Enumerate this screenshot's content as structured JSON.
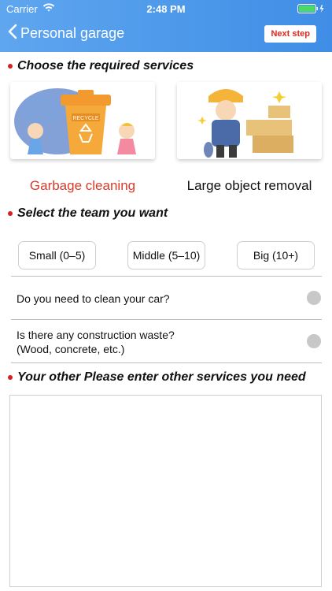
{
  "status_bar": {
    "carrier": "Carrier",
    "time": "2:48 PM"
  },
  "header": {
    "back_label": "Personal garage",
    "next_label": "Next step"
  },
  "sections": {
    "services_title": "Choose the required services",
    "team_title": "Select the team you want",
    "other_title": "Your other Please enter other services you need"
  },
  "services": [
    {
      "label": "Garbage cleaning",
      "selected": true,
      "color": "#d93a2b",
      "image_text": "RECYCLE"
    },
    {
      "label": "Large object removal",
      "selected": false
    }
  ],
  "teams": [
    {
      "label": "Small (0–5)"
    },
    {
      "label": "Middle (5–10)"
    },
    {
      "label": "Big (10+)"
    }
  ],
  "questions": [
    {
      "line1": "Do you need to clean your car?"
    },
    {
      "line1": "Is there any construction waste?",
      "line2": "(Wood, concrete, etc.)"
    }
  ],
  "colors": {
    "header_start": "#5fa6ef",
    "header_end": "#3f8de6",
    "accent_red": "#d81f1f",
    "battery_green": "#4cd964"
  }
}
